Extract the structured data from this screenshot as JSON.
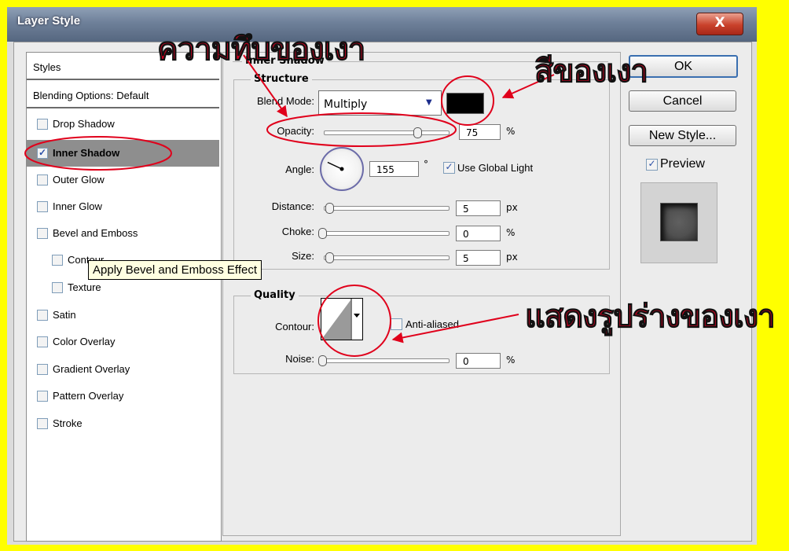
{
  "window": {
    "title": "Layer Style",
    "close_label": "X"
  },
  "styles_list": {
    "header": "Styles",
    "blending": "Blending Options: Default",
    "items": [
      {
        "label": "Drop Shadow",
        "checked": false,
        "selected": false
      },
      {
        "label": "Inner Shadow",
        "checked": true,
        "selected": true
      },
      {
        "label": "Outer Glow",
        "checked": false,
        "selected": false
      },
      {
        "label": "Inner Glow",
        "checked": false,
        "selected": false
      },
      {
        "label": "Bevel and Emboss",
        "checked": false,
        "selected": false
      },
      {
        "label": "Contour",
        "checked": false,
        "selected": false,
        "indent": true
      },
      {
        "label": "Texture",
        "checked": false,
        "selected": false,
        "indent": true
      },
      {
        "label": "Satin",
        "checked": false,
        "selected": false
      },
      {
        "label": "Color Overlay",
        "checked": false,
        "selected": false
      },
      {
        "label": "Gradient Overlay",
        "checked": false,
        "selected": false
      },
      {
        "label": "Pattern Overlay",
        "checked": false,
        "selected": false
      },
      {
        "label": "Stroke",
        "checked": false,
        "selected": false
      }
    ],
    "tooltip": "Apply Bevel and Emboss Effect"
  },
  "inner_shadow": {
    "section_title": "Inner Shadow",
    "structure_title": "Structure",
    "blend_mode_label": "Blend Mode:",
    "blend_mode_value": "Multiply",
    "shadow_color": "#000000",
    "opacity_label": "Opacity:",
    "opacity_value": "75",
    "opacity_unit": "%",
    "opacity_fraction": 0.75,
    "angle_label": "Angle:",
    "angle_value": "155",
    "angle_unit": "°",
    "angle_degrees": 155,
    "use_global_light_label": "Use Global Light",
    "use_global_light_checked": true,
    "distance_label": "Distance:",
    "distance_value": "5",
    "distance_unit": "px",
    "choke_label": "Choke:",
    "choke_value": "0",
    "choke_unit": "%",
    "size_label": "Size:",
    "size_value": "5",
    "size_unit": "px",
    "quality_title": "Quality",
    "contour_label": "Contour:",
    "anti_aliased_label": "Anti-aliased",
    "anti_aliased_checked": false,
    "noise_label": "Noise:",
    "noise_value": "0",
    "noise_unit": "%"
  },
  "buttons": {
    "ok": "OK",
    "cancel": "Cancel",
    "new_style": "New Style...",
    "preview_label": "Preview",
    "preview_checked": true
  },
  "annotations": {
    "opacity_note": "ความทึบของเงา",
    "color_note": "สีของเงา",
    "contour_note": "แสดงรูปร่างของเงา",
    "highlight_color": "#e0001b"
  }
}
